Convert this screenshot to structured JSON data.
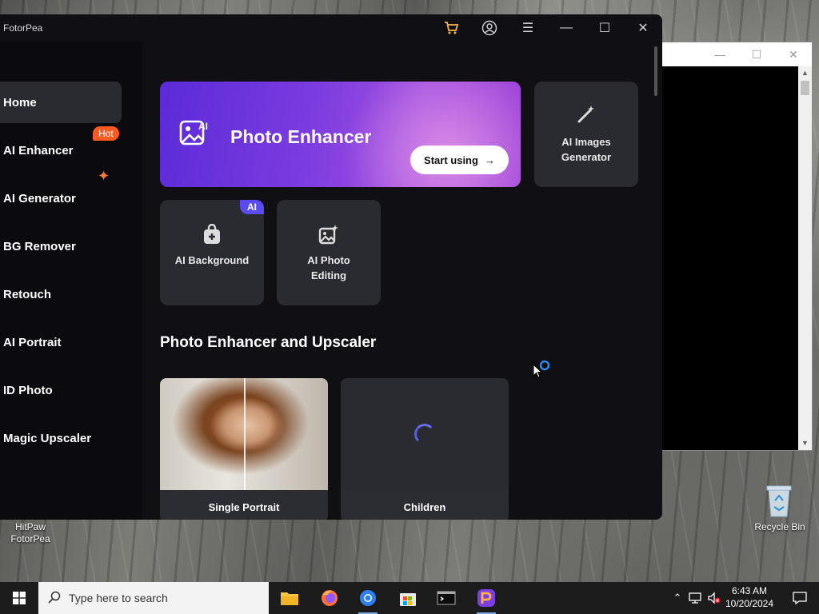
{
  "app": {
    "title": "FotorPea"
  },
  "sidebar": {
    "items": [
      {
        "label": "Home"
      },
      {
        "label": "AI Enhancer"
      },
      {
        "label": "AI Generator"
      },
      {
        "label": "BG Remover"
      },
      {
        "label": "Retouch"
      },
      {
        "label": "AI Portrait"
      },
      {
        "label": "ID Photo"
      },
      {
        "label": "Magic Upscaler"
      }
    ],
    "hot_badge": "Hot"
  },
  "hero": {
    "title": "Photo Enhancer",
    "button_label": "Start using"
  },
  "tiles": {
    "ai_images_generator": "AI Images Generator",
    "ai_background": "AI Background",
    "ai_photo_editing": "AI Photo Editing",
    "ai_badge": "AI"
  },
  "section": {
    "title": "Photo Enhancer and Upscaler",
    "cards": [
      {
        "label": "Single Portrait"
      },
      {
        "label": "Children"
      }
    ]
  },
  "desktop": {
    "shortcut_label": "HitPaw FotorPea",
    "recycle_bin_label": "Recycle Bin"
  },
  "taskbar": {
    "search_placeholder": "Type here to search",
    "time": "6:43 AM",
    "date": "10/20/2024"
  },
  "colors": {
    "accent": "#7a3bdf",
    "hot": "#ff5a1f",
    "ai_badge": "#5b4cf0"
  }
}
